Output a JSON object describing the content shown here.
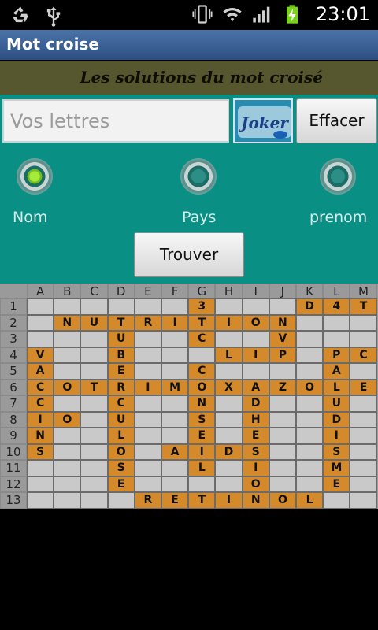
{
  "status_bar": {
    "icons": [
      "recycle-icon",
      "usb-icon",
      "vibrate-icon",
      "wifi-icon",
      "signal-icon",
      "battery-charging-icon"
    ],
    "time": "23:01"
  },
  "app": {
    "title": "Mot croise"
  },
  "banner": {
    "text": "Les solutions du mot croisé"
  },
  "input": {
    "value": "",
    "placeholder": "Vos lettres"
  },
  "joker": {
    "label": "Joker"
  },
  "buttons": {
    "clear": "Effacer",
    "find": "Trouver"
  },
  "radios": [
    {
      "label": "Nom",
      "checked": true
    },
    {
      "label": "Pays",
      "checked": false
    },
    {
      "label": "prenom",
      "checked": false
    }
  ],
  "grid": {
    "columns": [
      "A",
      "B",
      "C",
      "D",
      "E",
      "F",
      "G",
      "H",
      "I",
      "J",
      "K",
      "L",
      "M"
    ],
    "rows": [
      [
        "",
        "",
        "",
        "",
        "",
        "",
        "3",
        "",
        "",
        "",
        "D",
        "4",
        "T"
      ],
      [
        "",
        "N",
        "U",
        "T",
        "R",
        "I",
        "T",
        "I",
        "O",
        "N",
        "",
        "",
        ""
      ],
      [
        "",
        "",
        "",
        "U",
        "",
        "",
        "C",
        "",
        "",
        "V",
        "",
        "",
        ""
      ],
      [
        "V",
        "",
        "",
        "B",
        "",
        "",
        "",
        "L",
        "I",
        "P",
        "",
        "P",
        "C"
      ],
      [
        "A",
        "",
        "",
        "E",
        "",
        "",
        "C",
        "",
        "",
        "",
        "",
        "A",
        ""
      ],
      [
        "C",
        "O",
        "T",
        "R",
        "I",
        "M",
        "O",
        "X",
        "A",
        "Z",
        "O",
        "L",
        "E"
      ],
      [
        "C",
        "",
        "",
        "C",
        "",
        "",
        "N",
        "",
        "D",
        "",
        "",
        "U",
        ""
      ],
      [
        "I",
        "O",
        "",
        "U",
        "",
        "",
        "S",
        "",
        "H",
        "",
        "",
        "D",
        ""
      ],
      [
        "N",
        "",
        "",
        "L",
        "",
        "",
        "E",
        "",
        "E",
        "",
        "",
        "I",
        ""
      ],
      [
        "S",
        "",
        "",
        "O",
        "",
        "A",
        "I",
        "D",
        "S",
        "",
        "",
        "S",
        ""
      ],
      [
        "",
        "",
        "",
        "S",
        "",
        "",
        "L",
        "",
        "I",
        "",
        "",
        "M",
        ""
      ],
      [
        "",
        "",
        "",
        "E",
        "",
        "",
        "",
        "",
        "O",
        "",
        "",
        "E",
        ""
      ],
      [
        "",
        "",
        "",
        "",
        "R",
        "E",
        "T",
        "I",
        "N",
        "O",
        "L",
        "",
        ""
      ]
    ],
    "filled": [
      [
        0,
        0,
        0,
        0,
        0,
        0,
        1,
        0,
        0,
        0,
        1,
        1,
        1
      ],
      [
        0,
        1,
        1,
        1,
        1,
        1,
        1,
        1,
        1,
        1,
        0,
        0,
        0
      ],
      [
        0,
        0,
        0,
        1,
        0,
        0,
        1,
        0,
        0,
        1,
        0,
        0,
        0
      ],
      [
        1,
        0,
        0,
        1,
        0,
        0,
        0,
        1,
        1,
        1,
        0,
        1,
        1
      ],
      [
        1,
        0,
        0,
        1,
        0,
        0,
        1,
        0,
        0,
        0,
        0,
        1,
        0
      ],
      [
        1,
        1,
        1,
        1,
        1,
        1,
        1,
        1,
        1,
        1,
        1,
        1,
        1
      ],
      [
        1,
        0,
        0,
        1,
        0,
        0,
        1,
        0,
        1,
        0,
        0,
        1,
        0
      ],
      [
        1,
        1,
        0,
        1,
        0,
        0,
        1,
        0,
        1,
        0,
        0,
        1,
        0
      ],
      [
        1,
        0,
        0,
        1,
        0,
        0,
        1,
        0,
        1,
        0,
        0,
        1,
        0
      ],
      [
        1,
        0,
        0,
        1,
        0,
        1,
        1,
        1,
        1,
        0,
        0,
        1,
        0
      ],
      [
        0,
        0,
        0,
        1,
        0,
        0,
        1,
        0,
        1,
        0,
        0,
        1,
        0
      ],
      [
        0,
        0,
        0,
        1,
        0,
        0,
        0,
        0,
        1,
        0,
        0,
        1,
        0
      ],
      [
        0,
        0,
        0,
        0,
        1,
        1,
        1,
        1,
        1,
        1,
        1,
        0,
        0
      ]
    ],
    "colors": {
      "filled": "#d48a2a",
      "empty": "#c9c9c9",
      "header": "#9a9a9a"
    }
  }
}
